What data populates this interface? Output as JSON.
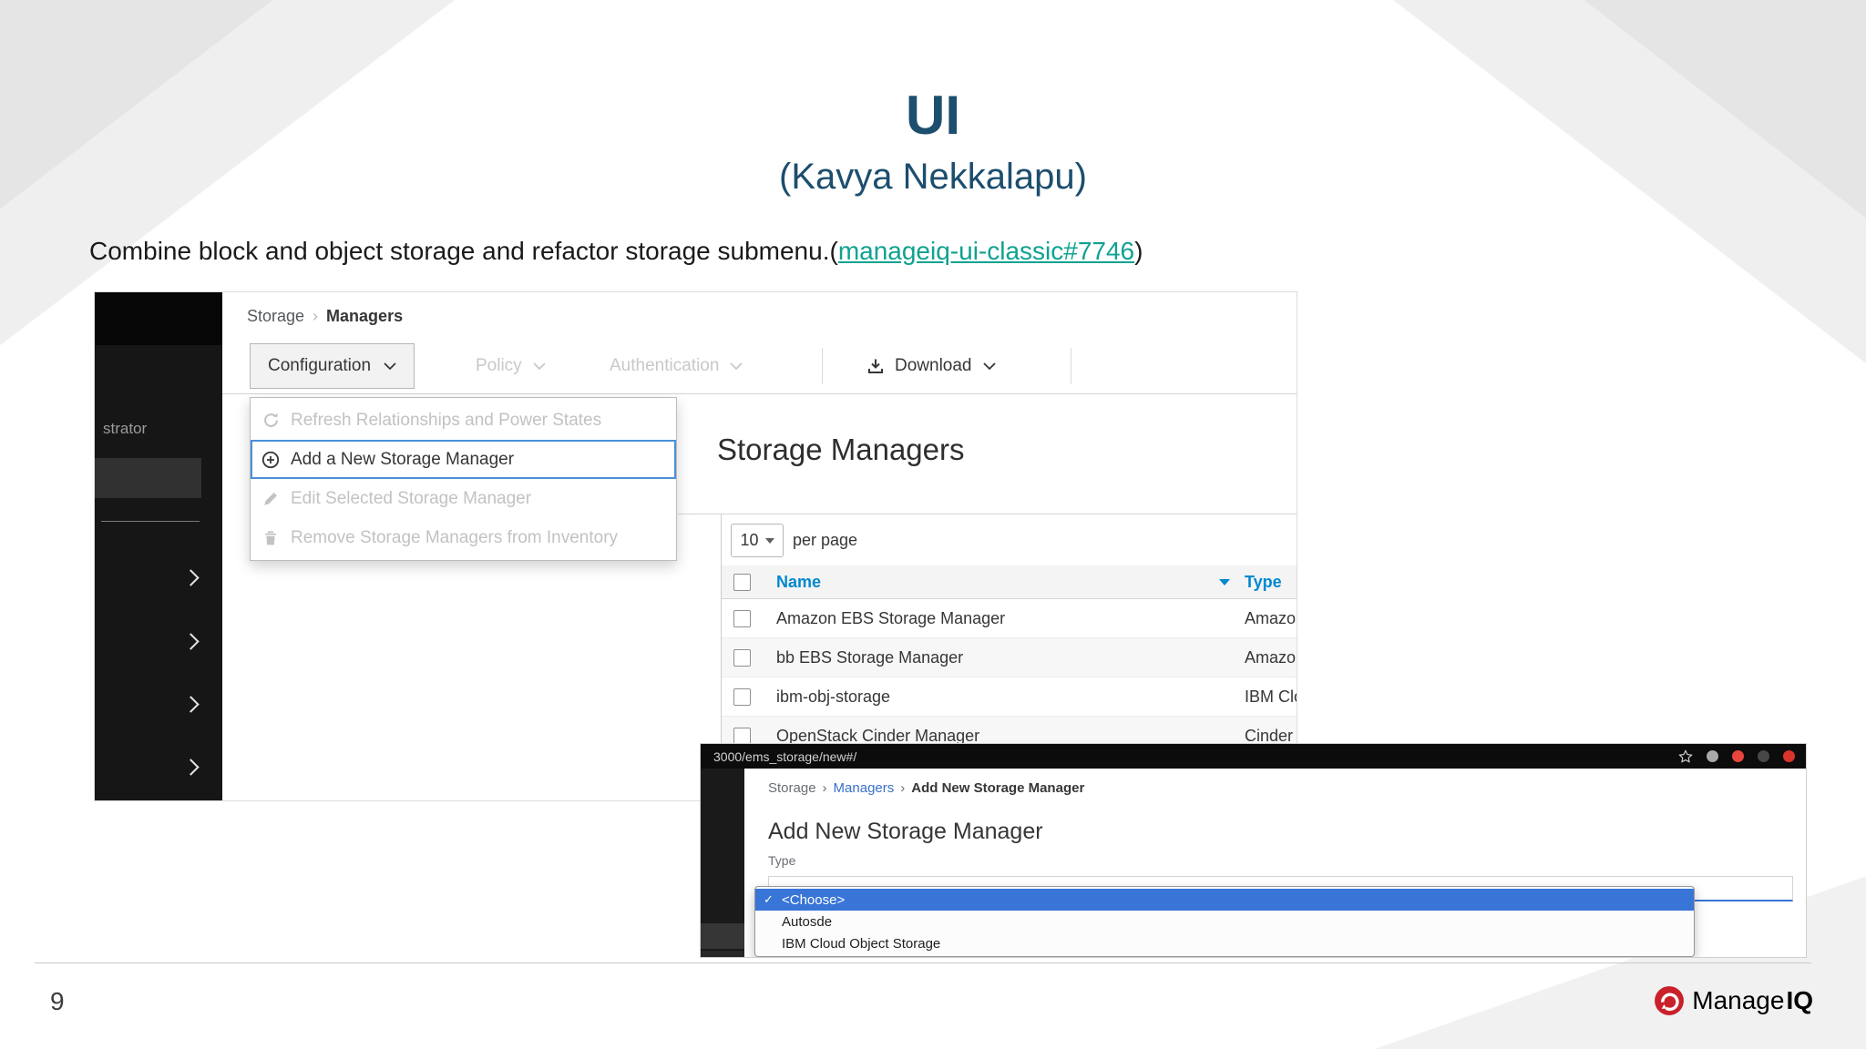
{
  "colors": {
    "navy": "#1c4e6e",
    "teal": "#0fa290",
    "pf-blue": "#0088ce",
    "focus-blue": "#4a90d9",
    "select-blue": "#3875d7",
    "logo-red": "#c9202a"
  },
  "slide": {
    "title": "UI",
    "subtitle": "(Kavya Nekkalapu)",
    "body_prefix": "Combine block and object storage and refactor storage submenu.(",
    "body_link": "manageiq-ui-classic#7746",
    "body_suffix": ")",
    "page_number": "9",
    "logo": {
      "manage": "Manage",
      "iq": "IQ"
    }
  },
  "screenshot1": {
    "sidebar": {
      "partial_item": "strator"
    },
    "breadcrumb": {
      "separator": "›",
      "items": [
        "Storage",
        "Managers"
      ]
    },
    "toolbar": {
      "configuration": "Configuration",
      "policy": "Policy",
      "authentication": "Authentication",
      "download": "Download"
    },
    "config_menu": {
      "items": [
        {
          "label": "Refresh Relationships and Power States",
          "icon": "refresh-icon",
          "state": "disabled"
        },
        {
          "label": "Add a New Storage Manager",
          "icon": "plus-circle-icon",
          "state": "focused"
        },
        {
          "label": "Edit Selected Storage Manager",
          "icon": "pencil-icon",
          "state": "disabled"
        },
        {
          "label": "Remove Storage Managers from Inventory",
          "icon": "trash-icon",
          "state": "disabled"
        }
      ]
    },
    "page_title": "Storage Managers",
    "pagination": {
      "per_page_value": "10",
      "per_page_label": "per page"
    },
    "table": {
      "headers": [
        "Name",
        "Type"
      ],
      "rows": [
        {
          "name": "Amazon EBS Storage Manager",
          "type": "Amazon"
        },
        {
          "name": "bb EBS Storage Manager",
          "type": "Amazon"
        },
        {
          "name": "ibm-obj-storage",
          "type": "IBM Clou"
        },
        {
          "name": "OpenStack Cinder Manager",
          "type": "Cinder"
        }
      ]
    }
  },
  "screenshot2": {
    "browser": {
      "url": "3000/ems_storage/new#/"
    },
    "breadcrumb": {
      "separator": "›",
      "items": [
        "Storage",
        "Managers",
        "Add New Storage Manager"
      ]
    },
    "title": "Add New Storage Manager",
    "form": {
      "type_label": "Type"
    },
    "type_dropdown": {
      "checkmark": "✓",
      "options": [
        {
          "label": "<Choose>",
          "selected": true
        },
        {
          "label": "Autosde",
          "selected": false
        },
        {
          "label": "IBM Cloud Object Storage",
          "selected": false
        }
      ]
    }
  }
}
